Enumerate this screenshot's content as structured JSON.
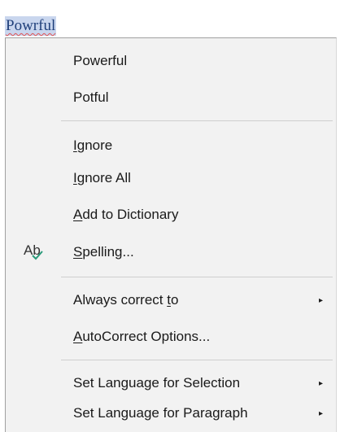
{
  "document": {
    "misspelled_word": "Powrful"
  },
  "menu": {
    "suggestions": [
      "Powerful",
      "Potful"
    ],
    "ignore": {
      "pre": "",
      "key": "I",
      "post": "gnore"
    },
    "ignore_all": {
      "pre": "",
      "key": "I",
      "post": "gnore All"
    },
    "add_to_dictionary": {
      "pre": "",
      "key": "A",
      "post": "dd to Dictionary"
    },
    "spelling": {
      "pre": "",
      "key": "S",
      "post": "pelling..."
    },
    "spelling_icon": "spelling-check-icon",
    "spelling_icon_text": "Ab",
    "always_correct_to": {
      "pre": "Always correct ",
      "key": "t",
      "post": "o"
    },
    "autocorrect_options": {
      "pre": "",
      "key": "A",
      "post": "utoCorrect Options..."
    },
    "set_language_selection": "Set Language for Selection",
    "set_language_paragraph": "Set Language for Paragraph",
    "submenu_arrow": "▸"
  }
}
